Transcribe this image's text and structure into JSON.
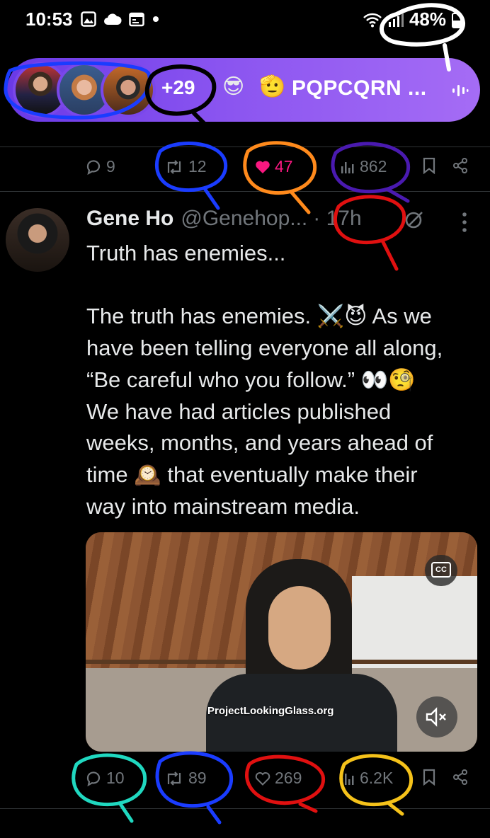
{
  "status_bar": {
    "time": "10:53",
    "battery": "48%",
    "left_icons": [
      "gallery-icon",
      "cloud-icon",
      "calendar-icon",
      "dot-icon"
    ],
    "right_icons": [
      "wifi-icon",
      "signal-icon",
      "battery-icon"
    ]
  },
  "spaces": {
    "listener_count": "+29",
    "separator": "·",
    "emojis": [
      "😎",
      "🫡"
    ],
    "title": "PQPCQRN ...",
    "icons": [
      "audio-icon"
    ],
    "gradient": [
      "#6a39e6",
      "#a56cf5"
    ]
  },
  "prev_post_actions": {
    "replies": "9",
    "reposts": "12",
    "likes": "47",
    "views": "862"
  },
  "post": {
    "author_name": "Gene Ho",
    "handle": "@Genehop...",
    "time": "· 17h",
    "lines": [
      "Truth has enemies...",
      "",
      "The truth has enemies. ⚔️😈 As we",
      "have been telling everyone all along,",
      "“Be careful who you follow.” 👀🧐",
      "We have had articles published",
      "weeks, months, and years ahead of",
      "time 🕰️ that eventually make their",
      "way into mainstream media."
    ],
    "media": {
      "watermark": "ProjectLookingGlass.org",
      "cc_label": "CC"
    }
  },
  "post_actions": {
    "replies": "10",
    "reposts": "89",
    "likes": "269",
    "views": "6.2K"
  },
  "colors": {
    "muted": "#71767b",
    "like": "#f91880",
    "annotation_blue": "#1a3cff",
    "annotation_orange": "#ff8a1c",
    "annotation_purple": "#4a1ab0",
    "annotation_red": "#e01010",
    "annotation_cyan": "#20d8c0",
    "annotation_yellow": "#f5c21a",
    "annotation_white": "#ffffff",
    "annotation_black": "#000000"
  }
}
